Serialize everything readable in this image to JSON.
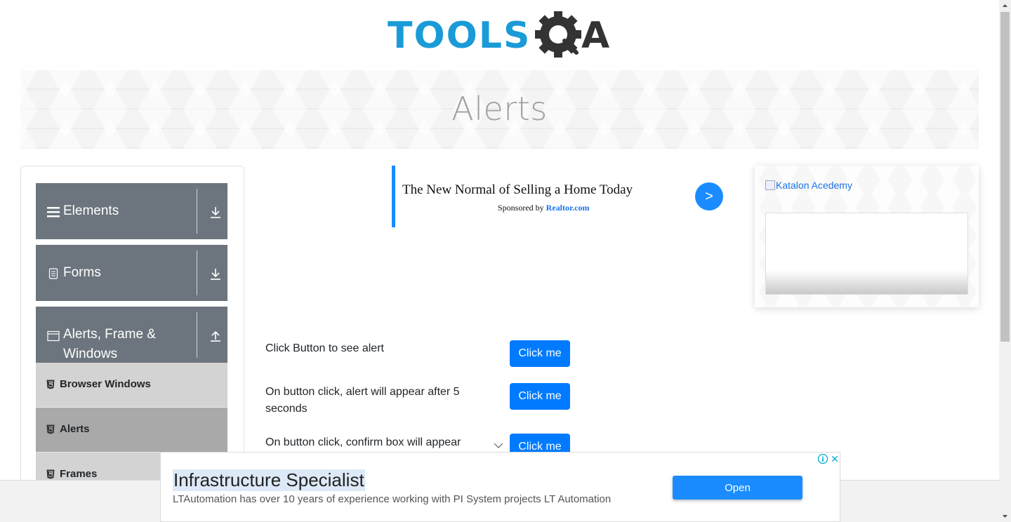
{
  "header": {
    "logo_text_left": "TOOLS",
    "logo_text_right": "A",
    "logo_colors": {
      "primary": "#1a9bd7",
      "dark": "#333333"
    }
  },
  "banner": {
    "title": "Alerts"
  },
  "sidebar": {
    "groups": [
      {
        "label": "Elements",
        "icon": "hamburger-icon",
        "arrow": "download-arrow-icon"
      },
      {
        "label": "Forms",
        "icon": "document-icon",
        "arrow": "download-arrow-icon"
      },
      {
        "label": "Alerts, Frame & Windows",
        "icon": "window-icon",
        "arrow": "upload-arrow-icon"
      }
    ],
    "items": [
      {
        "label": "Browser Windows",
        "active": false
      },
      {
        "label": "Alerts",
        "active": true
      },
      {
        "label": "Frames",
        "active": false
      }
    ]
  },
  "ads": {
    "center": {
      "title": "The New Normal of Selling a Home Today",
      "sponsor_prefix": "Sponsored by",
      "sponsor_brand": "Realtor.com",
      "go_label": ">"
    },
    "right": {
      "link_text": "Katalon Acedemy"
    },
    "bottom": {
      "title": "Infrastructure Specialist",
      "description": "LTAutomation has over 10 years of experience working with PI System projects LT Automation",
      "button_label": "Open",
      "close_label": "✕",
      "info_label": "i"
    }
  },
  "alerts": [
    {
      "label": "Click Button to see alert",
      "button": "Click me"
    },
    {
      "label": "On button click, alert will appear after 5 seconds",
      "button": "Click me"
    },
    {
      "label": "On button click, confirm box will appear",
      "button": "Click me"
    }
  ],
  "colors": {
    "accent": "#007bff",
    "menu_group": "#6c757d",
    "menu_item": "#d3d3d3",
    "menu_item_active": "#a9a9a9"
  }
}
